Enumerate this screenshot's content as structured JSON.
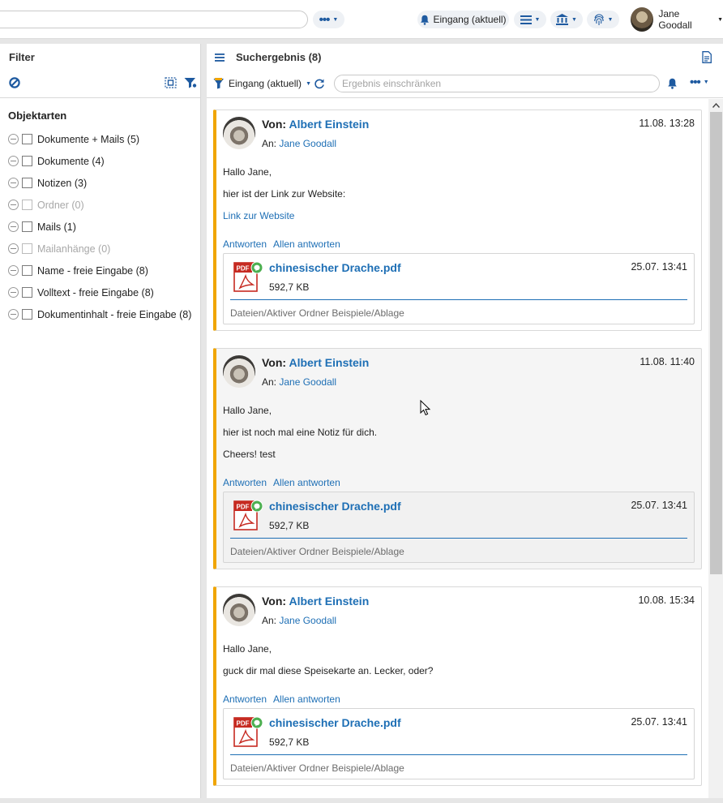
{
  "topbar": {
    "inbox_label": "Eingang (aktuell)",
    "user_name": "Jane Goodall",
    "icons": [
      "more-dots-icon",
      "bell-icon",
      "menu-list-icon",
      "bank-icon",
      "fingerprint-icon"
    ]
  },
  "filter": {
    "title": "Filter",
    "section_title": "Objektarten",
    "items": [
      {
        "label": "Dokumente + Mails (5)",
        "disabled": false
      },
      {
        "label": "Dokumente (4)",
        "disabled": false
      },
      {
        "label": "Notizen (3)",
        "disabled": false
      },
      {
        "label": "Ordner (0)",
        "disabled": true
      },
      {
        "label": "Mails (1)",
        "disabled": false
      },
      {
        "label": "Mailanhänge (0)",
        "disabled": true
      },
      {
        "label": "Name - freie Eingabe (8)",
        "disabled": false
      },
      {
        "label": "Volltext - freie Eingabe (8)",
        "disabled": false
      },
      {
        "label": "Dokumentinhalt - freie Eingabe (8)",
        "disabled": false
      }
    ]
  },
  "results": {
    "title": "Suchergebnis (8)",
    "inbox_label": "Eingang (aktuell)",
    "narrow_placeholder": "Ergebnis einschränken",
    "from_prefix": "Von:",
    "to_prefix": "An:",
    "reply_label": "Antworten",
    "reply_all_label": "Allen antworten",
    "cards": [
      {
        "from": "Albert Einstein",
        "to": "Jane Goodall",
        "time": "11.08. 13:28",
        "lines": [
          "Hallo Jane,",
          "hier ist der Link zur Website:"
        ],
        "link": "Link zur Website",
        "attachment": {
          "name": "chinesischer Drache.pdf",
          "size": "592,7 KB",
          "date": "25.07. 13:41",
          "path": [
            "Dateien",
            "Aktiver Ordner Beispiele",
            "Ablage"
          ]
        }
      },
      {
        "from": "Albert Einstein",
        "to": "Jane Goodall",
        "time": "11.08. 11:40",
        "lines": [
          "Hallo Jane,",
          "hier ist noch mal eine Notiz für dich.",
          "Cheers! test"
        ],
        "attachment": {
          "name": "chinesischer Drache.pdf",
          "size": "592,7 KB",
          "date": "25.07. 13:41",
          "path": [
            "Dateien",
            "Aktiver Ordner Beispiele",
            "Ablage"
          ]
        }
      },
      {
        "from": "Albert Einstein",
        "to": "Jane Goodall",
        "time": "10.08. 15:34",
        "lines": [
          "Hallo Jane,",
          "guck dir mal diese Speisekarte an. Lecker, oder?"
        ],
        "attachment": {
          "name": "chinesischer Drache.pdf",
          "size": "592,7 KB",
          "date": "25.07. 13:41",
          "path": [
            "Dateien",
            "Aktiver Ordner Beispiele",
            "Ablage"
          ]
        }
      }
    ]
  },
  "colors": {
    "accent": "#1e6fb5",
    "card_marker": "#f0a500",
    "pdf_red": "#c62a21",
    "badge_green": "#4caf50"
  }
}
